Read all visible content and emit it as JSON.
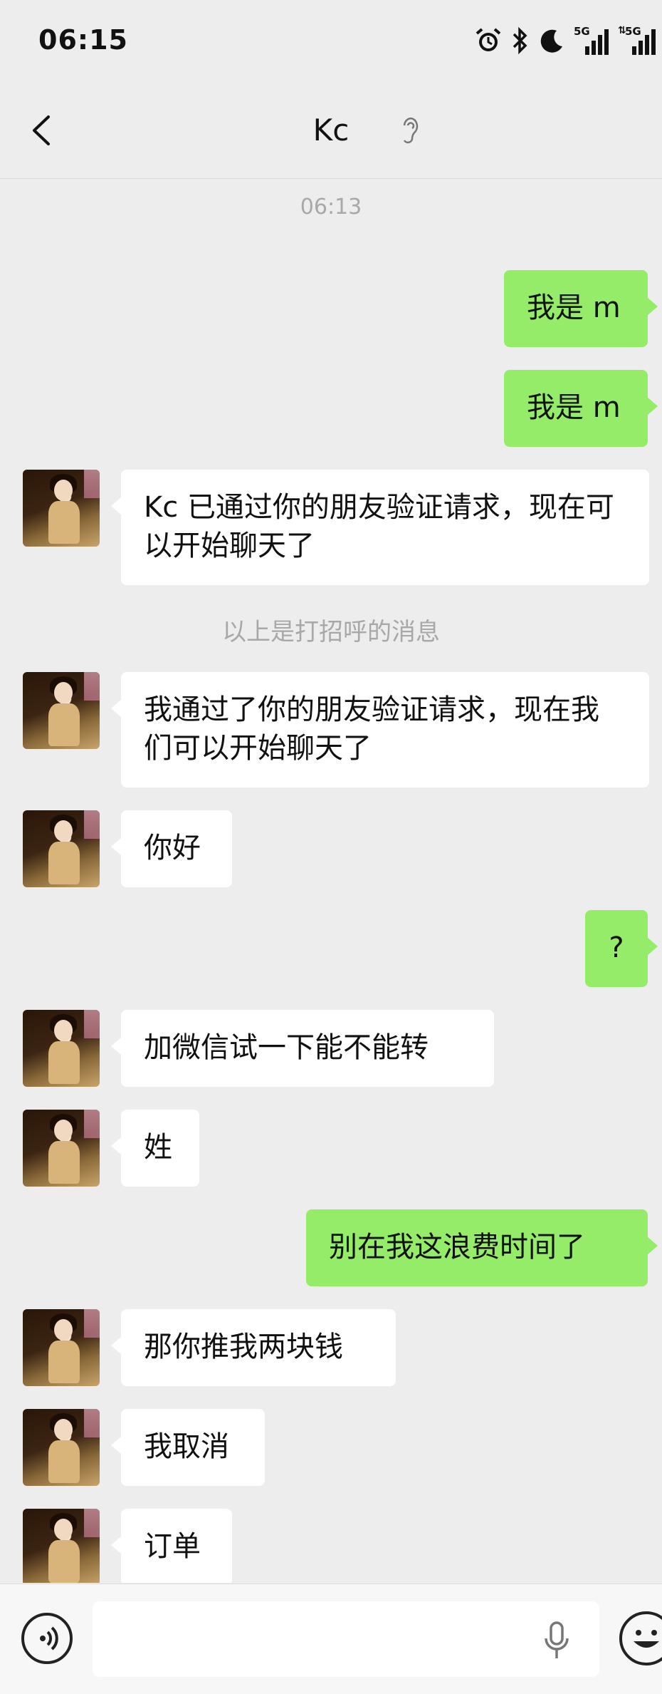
{
  "status_bar": {
    "time": "06:15",
    "icons": [
      "alarm-icon",
      "bluetooth-icon",
      "moon-icon",
      "signal-5g-icon",
      "signal-5g-icon"
    ],
    "network_label_1": "5G",
    "network_label_2": "5G"
  },
  "header": {
    "title": "Kc",
    "back_icon": "chevron-left-icon",
    "mode_icon": "ear-icon"
  },
  "chat": {
    "timestamp": "06:13",
    "greeting_note": "以上是打招呼的消息",
    "messages": [
      {
        "side": "out",
        "text": "我是 m"
      },
      {
        "side": "out",
        "text": "我是 m"
      },
      {
        "side": "in",
        "text": "Kc 已通过你的朋友验证请求，现在可以开始聊天了"
      },
      {
        "side": "in",
        "text": "我通过了你的朋友验证请求，现在我们可以开始聊天了"
      },
      {
        "side": "in",
        "text": "你好"
      },
      {
        "side": "out",
        "text": "?"
      },
      {
        "side": "in",
        "text": "加微信试一下能不能转"
      },
      {
        "side": "in",
        "text": "姓"
      },
      {
        "side": "out",
        "text": "别在我这浪费时间了"
      },
      {
        "side": "in",
        "text": "那你推我两块钱"
      },
      {
        "side": "in",
        "text": "我取消"
      },
      {
        "side": "in",
        "text": "订单"
      }
    ]
  },
  "input_bar": {
    "voice_icon": "voice-input-icon",
    "mic_icon": "microphone-icon",
    "emoji_icon": "emoji-icon"
  },
  "colors": {
    "background": "#ededed",
    "outgoing_bubble": "#95ec69",
    "incoming_bubble": "#ffffff",
    "note_text": "#a8a8a8"
  }
}
